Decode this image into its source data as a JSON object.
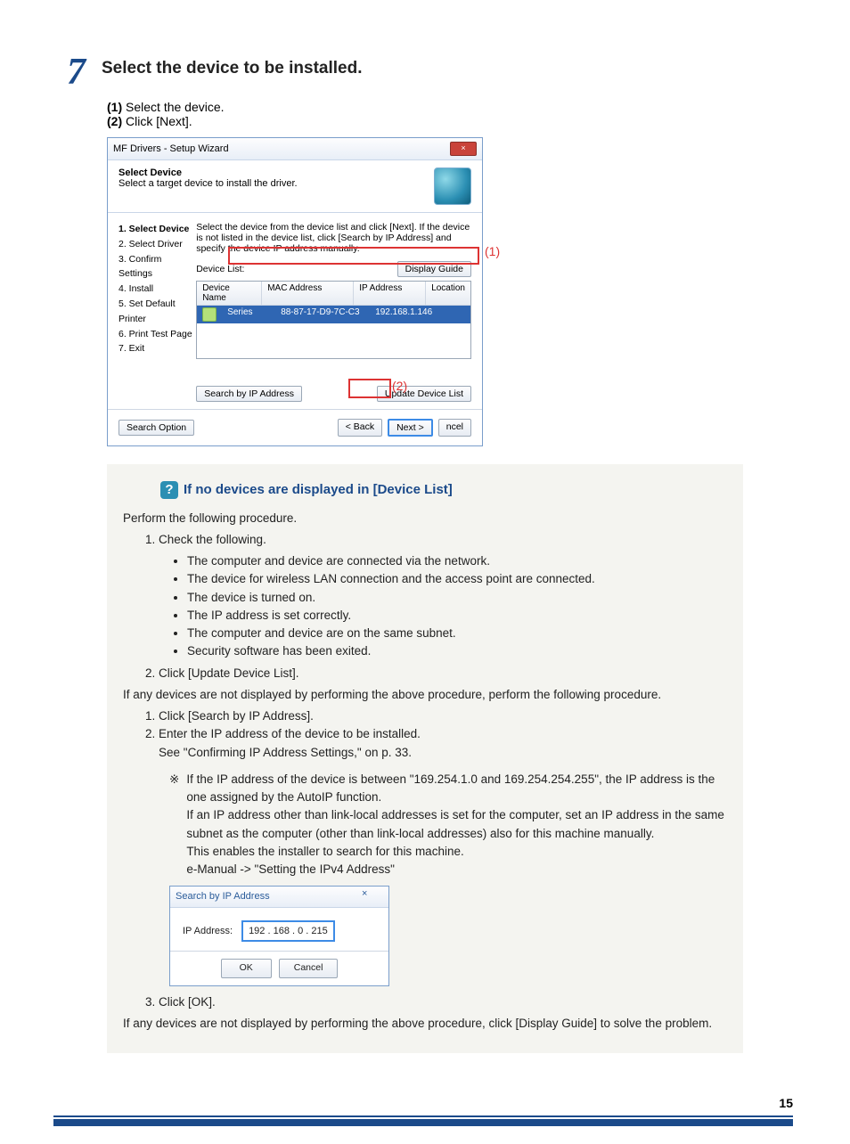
{
  "step": {
    "number": "7",
    "title": "Select the device to be installed.",
    "sub1_label": "(1)",
    "sub1_text": " Select the device.",
    "sub2_label": "(2)",
    "sub2_text": " Click [Next]."
  },
  "wizard": {
    "title": "MF Drivers - Setup Wizard",
    "close": "×",
    "header_title": "Select Device",
    "header_sub": "Select a target device to install the driver.",
    "steps": [
      "1.  Select Device",
      "2.  Select Driver",
      "3.  Confirm Settings",
      "4.  Install",
      "5.  Set Default Printer",
      "6.  Print Test Page",
      "7.  Exit"
    ],
    "desc": "Select the device from the device list and click [Next]. If the device is not listed in the device list, click [Search by IP Address] and specify the device IP address manually.",
    "device_list_label": "Device List:",
    "display_guide": "Display Guide",
    "cols": {
      "c1": "Device Name",
      "c2": "MAC Address",
      "c3": "IP Address",
      "c4": "Location"
    },
    "row": {
      "name": "Series",
      "mac": "88-87-17-D9-7C-C3",
      "ip": "192.168.1.146"
    },
    "search_by_ip": "Search by IP Address",
    "update_list": "Update Device List",
    "search_option": "Search Option",
    "back": "< Back",
    "next": "Next >",
    "cancel": "ncel"
  },
  "callouts": {
    "c1": "(1)",
    "c2": "(2)"
  },
  "note": {
    "title": "If no devices are displayed in [Device List]",
    "intro": "Perform the following procedure.",
    "li1": "Check the following.",
    "bullets": [
      "The computer and device are connected via the network.",
      "The device for wireless LAN connection and the access point are connected.",
      "The device is turned on.",
      "The IP address is set correctly.",
      "The computer and device are on the same subnet.",
      "Security software has been exited."
    ],
    "li2": "Click [Update Device List].",
    "p2": "If any devices are not displayed by performing the above procedure, perform the following procedure.",
    "ol2_1": "Click [Search by IP Address].",
    "ol2_2": "Enter the IP address of the device to be installed.",
    "ol2_2b": "See \"Confirming IP Address Settings,\" on p. 33.",
    "asterisk_label": "※",
    "asterisk1": "If the IP address of the device is between \"169.254.1.0 and 169.254.254.255\", the IP address is the one assigned by the AutoIP function.",
    "asterisk2": "If an IP address other than link-local addresses is set for the computer, set an IP address in the same subnet as the computer (other than link-local addresses) also for this machine manually.",
    "asterisk3": "This enables the installer to search for this machine.",
    "asterisk4": "e-Manual -> \"Setting the IPv4 Address\"",
    "ol2_3": "Click [OK].",
    "p3": "If any devices are not displayed by performing the above procedure, click [Display Guide] to solve the problem."
  },
  "ip_dialog": {
    "title": "Search by IP Address",
    "close": "×",
    "label": "IP Address:",
    "value": "192 . 168 .   0 . 215",
    "ok": "OK",
    "cancel": "Cancel"
  },
  "page_number": "15"
}
